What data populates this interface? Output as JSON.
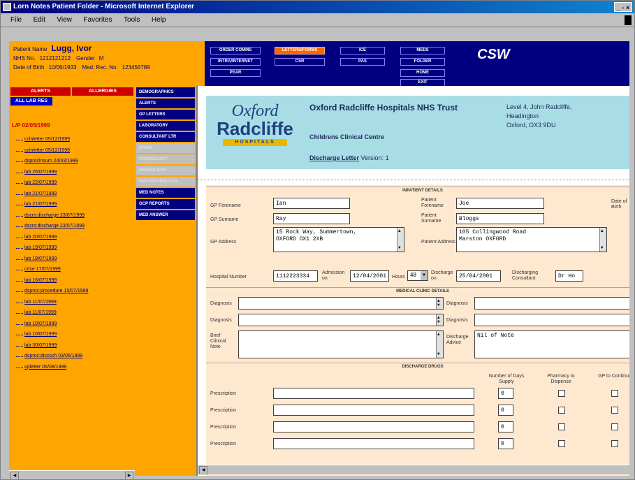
{
  "window": {
    "title": "Lorn Notes Patient Folder - Microsoft Internet Explorer",
    "controls": "_ ▫ ×"
  },
  "menubar": [
    "File",
    "Edit",
    "View",
    "Favorites",
    "Tools",
    "Help"
  ],
  "patient": {
    "name_label": "Patient Name",
    "name": "Lugg, Ivor",
    "nhs_label": "NHS No.",
    "nhs": "1212121212",
    "gender_label": "Gender",
    "gender": "M",
    "dob_label": "Date of Birth",
    "dob": "10/06/1933",
    "medrec_label": "Med. Rec. No.",
    "medrec": "123456789"
  },
  "nav": [
    {
      "label": "ORDER COMMS",
      "active": false
    },
    {
      "label": "LETTERS/FORMS",
      "active": true
    },
    {
      "label": "ICE",
      "active": false
    },
    {
      "label": "MEDS",
      "active": false
    },
    {
      "label": "FOLDER",
      "active": false
    },
    {
      "label": "INTRA/INTERNET",
      "active": false
    },
    {
      "label": "CSR",
      "active": false
    },
    {
      "label": "PAS",
      "active": false
    },
    {
      "label": "HOME",
      "active": false
    },
    {
      "label": "PEAR",
      "active": false
    },
    {
      "label": "EXIT",
      "active": false
    }
  ],
  "brand": "CSW",
  "left": {
    "alerts": "ALERTS",
    "allergies": "ALLERGIES",
    "all_lab_res": "ALL LAB RES",
    "root": "L/P 02/05/1999",
    "items": [
      "cclnletter 05/12/1999",
      "cclnletter 05/12/1999",
      "dsproclnsum 24/03/1999",
      "lab 25/07/1999",
      "lab 22/07/1999",
      "lab 21/07/1999",
      "lab 21/07/1999",
      "dscrs:discharge 23/07/1999",
      "dscrs:discharge 23/07/1999",
      "lab 20/07/1999",
      "lab 19/07/1999",
      "lab 19/07/1999",
      "crise 17/07/1999",
      "lab 16/07/1999",
      "dsproc:procedure 15/07/1999",
      "lab 11/07/1999",
      "lab 11/07/1999",
      "lab 10/07/1999",
      "lab 10/07/1999",
      "lab 30/07/1999",
      "dsproc:discsch 03/06/1999",
      "opletter 06/08/1999"
    ]
  },
  "sidemenu": [
    {
      "label": "DEMOGRAPHICS",
      "enabled": true
    },
    {
      "label": "ALERTS",
      "enabled": true
    },
    {
      "label": "GP LETTERS",
      "enabled": true
    },
    {
      "label": "LABORATORY",
      "enabled": true
    },
    {
      "label": "CONSULTANT LTR",
      "enabled": true
    },
    {
      "label": "RADIO",
      "enabled": false
    },
    {
      "label": "CARDIOLOGY",
      "enabled": false
    },
    {
      "label": "NEUROLOGY",
      "enabled": false
    },
    {
      "label": "HISTOPATHOLOGY",
      "enabled": false
    },
    {
      "label": "MED NOTES",
      "enabled": true
    },
    {
      "label": "GCP REPORTS",
      "enabled": true
    },
    {
      "label": "MED ANSWER",
      "enabled": true
    }
  ],
  "banner": {
    "logo_oxford": "Oxford",
    "logo_radcliffe": "Radcliffe",
    "logo_hospitals": "HOSPITALS",
    "title": "Oxford Radcliffe Hospitals NHS Trust",
    "subtitle": "Childrens Clinical Centre",
    "letter_label": "Discharge Letter",
    "version": "Version: 1",
    "address": [
      "Level 4, John Radcliffe,",
      "Headington",
      "Oxford, OX3 9DU"
    ]
  },
  "form": {
    "patient_details": "INPATIENT DETAILS",
    "gp_forename_label": "GP Forename",
    "gp_forename": "Ian",
    "gp_surname_label": "GP Surname",
    "gp_surname": "Ray",
    "gp_address_label": "GP Address",
    "gp_address": "15 Rock Way, Summertown,\nOXFORD OX1 2XB",
    "pt_forename_label": "Patient Forename",
    "pt_forename": "Joe",
    "pt_surname_label": "Patient Surname",
    "pt_surname": "Bloggs",
    "pt_address_label": "Patient Address",
    "pt_address": "105 Collingwood Road\nMarston OXFORD",
    "dob_label": "Date of Birth",
    "hosp_no_label": "Hospital Number",
    "hosp_no": "1112223334",
    "admission_label": "Admission on",
    "admission": "12/04/2001",
    "hours_label": "Hours",
    "hours": "48",
    "discharge_label": "Discharge on",
    "discharge": "25/04/2001",
    "consultant_label": "Discharging Consultant",
    "consultant": "Dr Ho",
    "medical_details": "MEDICAL CLINIC DETAILS",
    "diagnosis_label": "Diagnosis",
    "brief_label": "Brief Clinical Note",
    "advice_label": "Discharge Advice",
    "advice": "Nil of Note",
    "drugs": "DISCHARGE DRUGS",
    "col_days": "Number of Days Supply",
    "col_pharm": "Pharmacy to Dispense",
    "col_gp": "GP to Continue",
    "prescription_label": "Prescription",
    "days": "0"
  }
}
